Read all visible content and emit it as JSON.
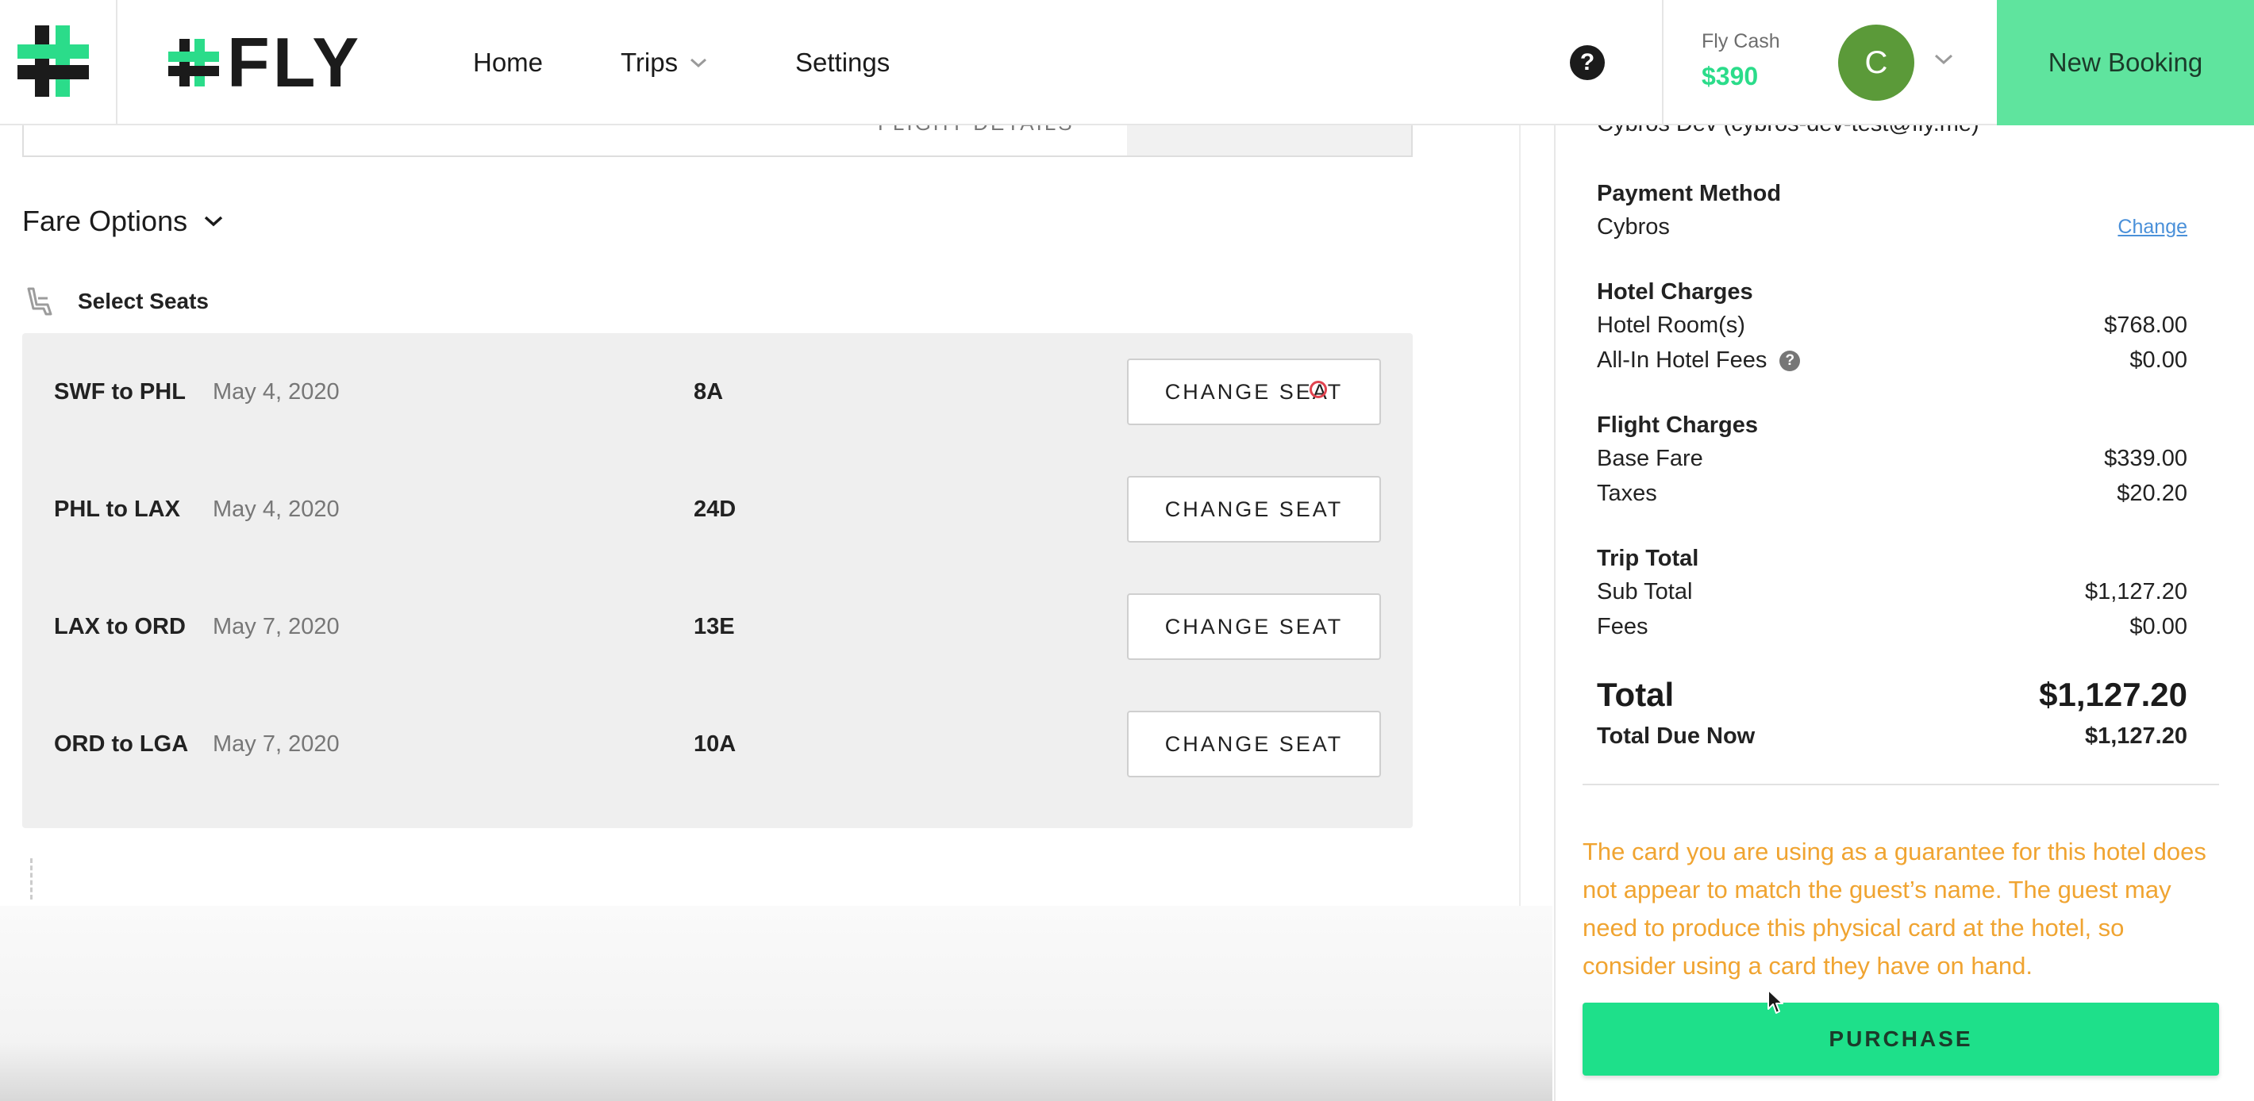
{
  "header": {
    "logo_text": "FLY",
    "nav": {
      "home": "Home",
      "trips": "Trips",
      "settings": "Settings"
    },
    "help_glyph": "?",
    "fly_cash_label": "Fly Cash",
    "fly_cash_value": "$390",
    "avatar_initial": "C",
    "new_booking": "New Booking"
  },
  "flight_card": {
    "details_label": "FLIGHT DETAILS"
  },
  "fare_options": {
    "title": "Fare Options"
  },
  "select_seats": {
    "title": "Select Seats",
    "rows": [
      {
        "route": "SWF to PHL",
        "date": "May 4, 2020",
        "seat": "8A",
        "button": "CHANGE SEAT"
      },
      {
        "route": "PHL to LAX",
        "date": "May 4, 2020",
        "seat": "24D",
        "button": "CHANGE SEAT"
      },
      {
        "route": "LAX to ORD",
        "date": "May 7, 2020",
        "seat": "13E",
        "button": "CHANGE SEAT"
      },
      {
        "route": "ORD to LGA",
        "date": "May 7, 2020",
        "seat": "10A",
        "button": "CHANGE SEAT"
      }
    ]
  },
  "summary": {
    "traveler": "Cybros Dev (cybros-dev-test@fly.me)",
    "payment_method_label": "Payment Method",
    "payment_method_value": "Cybros",
    "change_link": "Change",
    "hotel_charges_label": "Hotel Charges",
    "hotel_rooms_label": "Hotel Room(s)",
    "hotel_rooms_amount": "$768.00",
    "hotel_fees_label": "All-In Hotel Fees",
    "hotel_fees_amount": "$0.00",
    "flight_charges_label": "Flight Charges",
    "base_fare_label": "Base Fare",
    "base_fare_amount": "$339.00",
    "taxes_label": "Taxes",
    "taxes_amount": "$20.20",
    "trip_total_label": "Trip Total",
    "sub_total_label": "Sub Total",
    "sub_total_amount": "$1,127.20",
    "fees_label": "Fees",
    "fees_amount": "$0.00",
    "total_label": "Total",
    "total_amount": "$1,127.20",
    "total_due_label": "Total Due Now",
    "total_due_amount": "$1,127.20",
    "warning": "The card you are using as a guarantee for this hotel does not appear to match the guest’s name. The guest may need to produce this physical card at the hotel, so consider using a card they have on hand.",
    "purchase_button": "PURCHASE"
  },
  "colors": {
    "brand_green": "#2bdc8a",
    "new_booking_bg": "#5fe49e",
    "purchase_bg": "#1ee08a",
    "warning_text": "#f0a431",
    "avatar_bg": "#5b9a39",
    "link": "#4a90d9"
  },
  "icons": {
    "app": "fly-cross-logo-icon",
    "trips_dropdown": "chevron-down-icon",
    "help": "help-circle-icon",
    "avatar_dropdown": "chevron-down-icon",
    "fare_toggle": "chevron-down-icon",
    "seat": "seat-icon",
    "cursor": "mouse-cursor-icon"
  }
}
